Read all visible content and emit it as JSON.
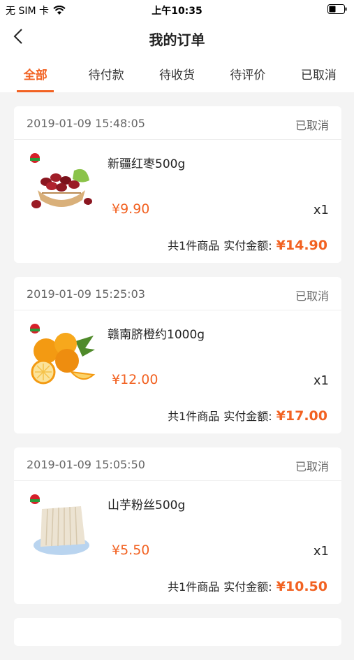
{
  "statusbar": {
    "carrier": "无 SIM 卡",
    "time": "上午10:35"
  },
  "navbar": {
    "title": "我的订单"
  },
  "tabs": [
    {
      "label": "全部",
      "active": true
    },
    {
      "label": "待付款",
      "active": false
    },
    {
      "label": "待收货",
      "active": false
    },
    {
      "label": "待评价",
      "active": false
    },
    {
      "label": "已取消",
      "active": false
    }
  ],
  "orders": [
    {
      "date": "2019-01-09 15:48:05",
      "status": "已取消",
      "product": "新疆红枣500g",
      "price": "¥9.90",
      "qty": "x1",
      "count_text": "共1件商品",
      "paid_label": "实付金额:",
      "total": "¥14.90"
    },
    {
      "date": "2019-01-09 15:25:03",
      "status": "已取消",
      "product": "赣南脐橙约1000g",
      "price": "¥12.00",
      "qty": "x1",
      "count_text": "共1件商品",
      "paid_label": "实付金额:",
      "total": "¥17.00"
    },
    {
      "date": "2019-01-09 15:05:50",
      "status": "已取消",
      "product": "山芋粉丝500g",
      "price": "¥5.50",
      "qty": "x1",
      "count_text": "共1件商品",
      "paid_label": "实付金额:",
      "total": "¥10.50"
    }
  ],
  "colors": {
    "accent": "#f26222",
    "background": "#f4f4f4"
  }
}
